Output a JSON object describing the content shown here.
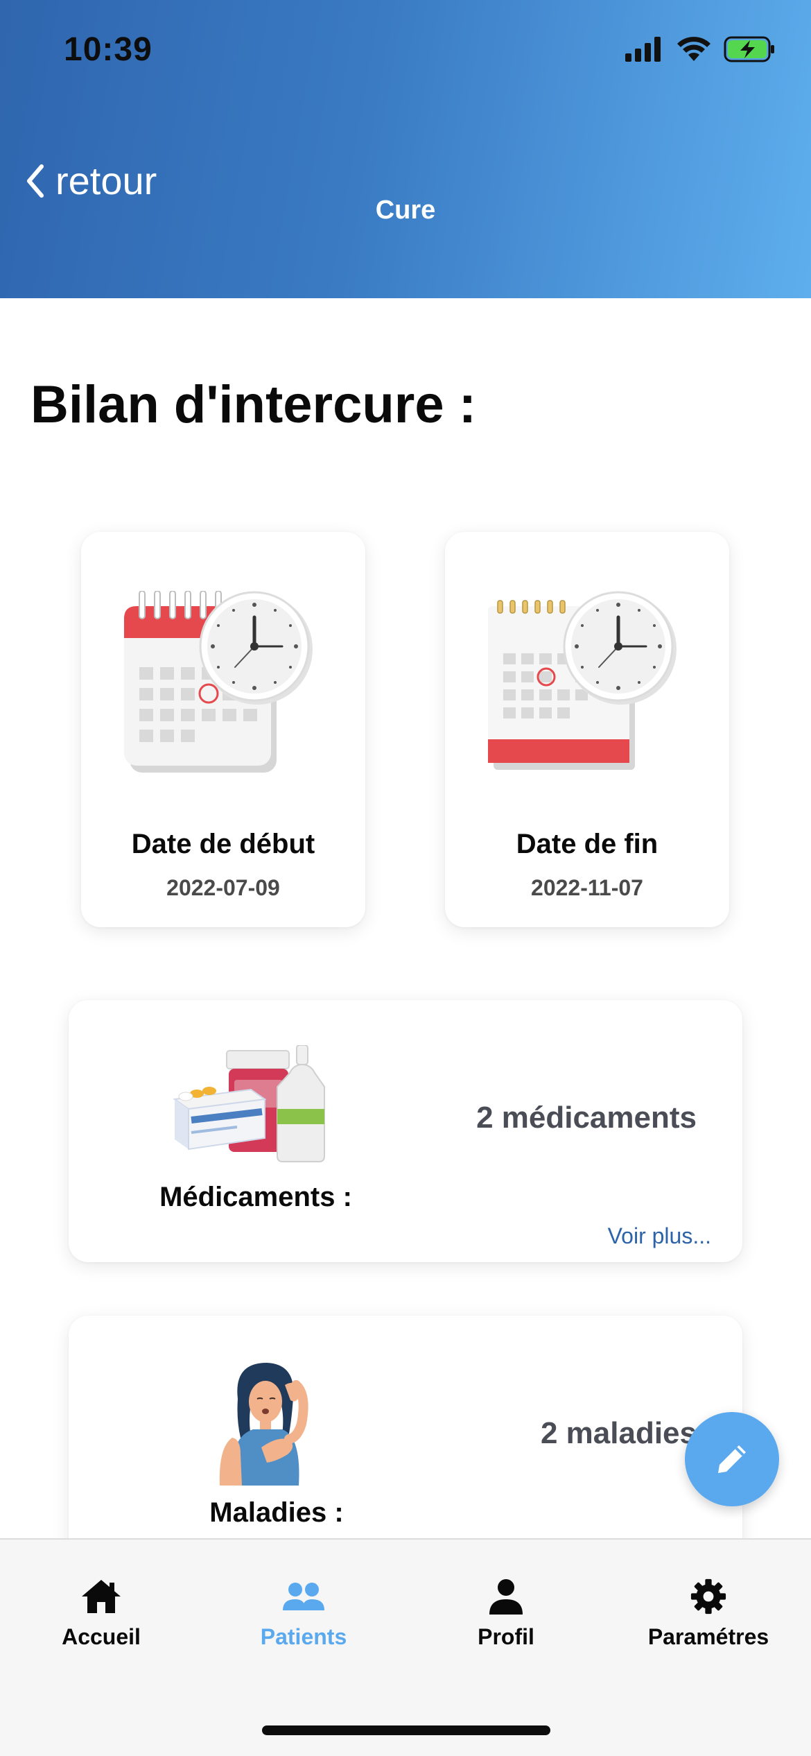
{
  "status_bar": {
    "time": "10:39"
  },
  "header": {
    "back_label": "retour",
    "title": "Cure"
  },
  "section_title": "Bilan d'intercure :",
  "date_cards": {
    "start": {
      "label": "Date de début",
      "value": "2022-07-09"
    },
    "end": {
      "label": "Date de fin",
      "value": "2022-11-07"
    }
  },
  "medicaments": {
    "label": "Médicaments :",
    "count": "2 médicaments",
    "more_link": "Voir plus..."
  },
  "maladies": {
    "label": "Maladies :",
    "count": "2 maladies"
  },
  "tabs": [
    {
      "label": "Accueil",
      "icon": "home-icon",
      "active": false
    },
    {
      "label": "Patients",
      "icon": "users-icon",
      "active": true
    },
    {
      "label": "Profil",
      "icon": "person-icon",
      "active": false
    },
    {
      "label": "Paramétres",
      "icon": "gear-icon",
      "active": false
    }
  ],
  "colors": {
    "accent": "#5aa9ee",
    "header_start": "#2f66ae",
    "header_end": "#5eaeed",
    "link": "#2d63a8"
  }
}
